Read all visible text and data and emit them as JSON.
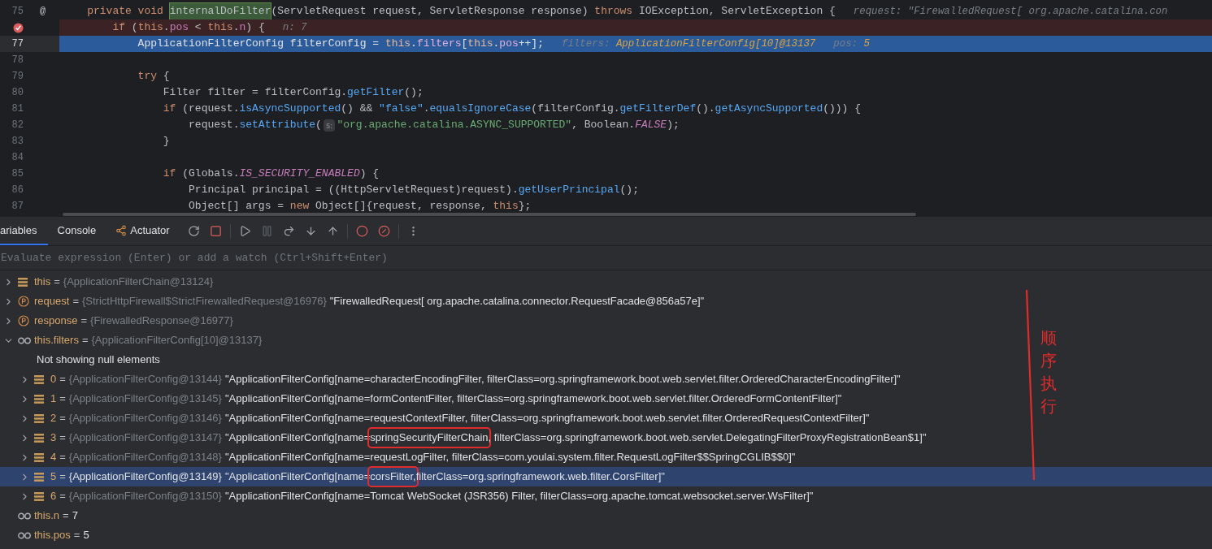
{
  "editor": {
    "lines": [
      {
        "number": "75",
        "gutter_mark": "@",
        "kind": "normal",
        "tokens": [
          {
            "t": "    private void ",
            "kind": "keyword"
          },
          {
            "t": "internalDoFilter",
            "kind": "usage"
          },
          {
            "t": "(ServletRequest request, ServletResponse response) ",
            "kind": "plain"
          },
          {
            "t": "throws",
            "kind": "keyword"
          },
          {
            "t": " IOException, ServletException {",
            "kind": "plain"
          }
        ],
        "hints": [
          {
            "label": "request: \"FirewalledRequest[ org.apache.catalina.con"
          }
        ]
      },
      {
        "kind": "breakpoint",
        "tokens": [
          {
            "t": "        if",
            "kind": "keyword"
          },
          {
            "t": " (",
            "kind": "plain"
          },
          {
            "t": "this",
            "kind": "keyword"
          },
          {
            "t": ".",
            "kind": "plain"
          },
          {
            "t": "pos",
            "kind": "field"
          },
          {
            "t": " < ",
            "kind": "plain"
          },
          {
            "t": "this",
            "kind": "keyword"
          },
          {
            "t": ".",
            "kind": "plain"
          },
          {
            "t": "n",
            "kind": "field"
          },
          {
            "t": ") {",
            "kind": "plain"
          }
        ],
        "hints": [
          {
            "label": "n: 7"
          }
        ]
      },
      {
        "number": "77",
        "kind": "current",
        "tokens": [
          {
            "t": "            ApplicationFilterConfig filterConfig = ",
            "kind": "plain"
          },
          {
            "t": "this",
            "kind": "keyword"
          },
          {
            "t": ".",
            "kind": "plain"
          },
          {
            "t": "filters",
            "kind": "field"
          },
          {
            "t": "[",
            "kind": "plain"
          },
          {
            "t": "this",
            "kind": "keyword"
          },
          {
            "t": ".",
            "kind": "plain"
          },
          {
            "t": "pos",
            "kind": "field"
          },
          {
            "t": "++];",
            "kind": "plain"
          }
        ],
        "hints": [
          {
            "label": "filters:",
            "value": "ApplicationFilterConfig[10]@13137"
          },
          {
            "label": "pos:",
            "value": "5"
          }
        ]
      },
      {
        "number": "78",
        "kind": "normal"
      },
      {
        "number": "79",
        "kind": "normal",
        "tokens": [
          {
            "t": "            try",
            "kind": "keyword"
          },
          {
            "t": " {",
            "kind": "plain"
          }
        ]
      },
      {
        "number": "80",
        "kind": "normal",
        "tokens": [
          {
            "t": "                Filter filter = filterConfig.",
            "kind": "plain"
          },
          {
            "t": "getFilter",
            "kind": "method"
          },
          {
            "t": "();",
            "kind": "plain"
          }
        ]
      },
      {
        "number": "81",
        "kind": "normal",
        "tokens": [
          {
            "t": "                if",
            "kind": "keyword"
          },
          {
            "t": " (request.",
            "kind": "plain"
          },
          {
            "t": "isAsyncSupported",
            "kind": "method"
          },
          {
            "t": "() && ",
            "kind": "plain"
          },
          {
            "t": "\"false\"",
            "kind": "method"
          },
          {
            "t": ".",
            "kind": "plain"
          },
          {
            "t": "equalsIgnoreCase",
            "kind": "method"
          },
          {
            "t": "(filterConfig.",
            "kind": "plain"
          },
          {
            "t": "getFilterDef",
            "kind": "method"
          },
          {
            "t": "().",
            "kind": "plain"
          },
          {
            "t": "getAsyncSupported",
            "kind": "method"
          },
          {
            "t": "())) {",
            "kind": "plain"
          }
        ]
      },
      {
        "number": "82",
        "kind": "normal",
        "tokens": [
          {
            "t": "                    request.",
            "kind": "plain"
          },
          {
            "t": "setAttribute",
            "kind": "method"
          },
          {
            "t": "(",
            "kind": "plain"
          },
          {
            "t": "s:",
            "kind": "param"
          },
          {
            "t": "\"org.apache.catalina.ASYNC_SUPPORTED\"",
            "kind": "string"
          },
          {
            "t": ", Boolean.",
            "kind": "plain"
          },
          {
            "t": "FALSE",
            "kind": "constant"
          },
          {
            "t": ");",
            "kind": "plain"
          }
        ]
      },
      {
        "number": "83",
        "kind": "normal",
        "tokens": [
          {
            "t": "                }",
            "kind": "plain"
          }
        ]
      },
      {
        "number": "84",
        "kind": "normal"
      },
      {
        "number": "85",
        "kind": "normal",
        "tokens": [
          {
            "t": "                if",
            "kind": "keyword"
          },
          {
            "t": " (Globals.",
            "kind": "plain"
          },
          {
            "t": "IS_SECURITY_ENABLED",
            "kind": "constant"
          },
          {
            "t": ") {",
            "kind": "plain"
          }
        ]
      },
      {
        "number": "86",
        "kind": "normal",
        "tokens": [
          {
            "t": "                    Principal principal = ((HttpServletRequest)request).",
            "kind": "plain"
          },
          {
            "t": "getUserPrincipal",
            "kind": "method"
          },
          {
            "t": "();",
            "kind": "plain"
          }
        ]
      },
      {
        "number": "87",
        "kind": "normal",
        "tokens": [
          {
            "t": "                    Object[] args = ",
            "kind": "plain"
          },
          {
            "t": "new",
            "kind": "keyword"
          },
          {
            "t": " Object[]{request, response, ",
            "kind": "plain"
          },
          {
            "t": "this",
            "kind": "keyword"
          },
          {
            "t": "};",
            "kind": "plain"
          }
        ]
      }
    ]
  },
  "debug_tabs": [
    {
      "label": "ariables",
      "selected": true
    },
    {
      "label": "Console",
      "selected": false
    },
    {
      "label": "Actuator",
      "selected": false
    }
  ],
  "evaluate": {
    "placeholder": "Evaluate expression (Enter) or add a watch (Ctrl+Shift+Enter)"
  },
  "variables": [
    {
      "kind": "field",
      "name": "this",
      "equals": "=",
      "value": "{ApplicationFilterChain@13124}",
      "expanded": false,
      "selected": false
    },
    {
      "kind": "param",
      "name": "request",
      "equals": "=",
      "value": "{StrictHttpFirewall$StrictFirewalledRequest@16976}",
      "string": [
        {
          "text": "\"FirewalledRequest[ org.apache.catalina.connector.RequestFacade@856a57e]\"",
          "boxed": false
        }
      ],
      "expanded": false,
      "selected": false
    },
    {
      "kind": "param",
      "name": "response",
      "equals": "=",
      "value": "{FirewalledResponse@16977}",
      "expanded": false,
      "selected": false
    },
    {
      "kind": "watch",
      "name": "this.filters",
      "equals": "=",
      "value": "{ApplicationFilterConfig[10]@13137}",
      "expanded": true,
      "selected": false,
      "note": "Not showing null elements",
      "children": [
        {
          "kind": "field",
          "name": "0",
          "equals": "=",
          "value": "{ApplicationFilterConfig@13144}",
          "string": [
            {
              "text": "\"ApplicationFilterConfig[name=characterEncodingFilter, filterClass=org.springframework.boot.web.servlet.filter.OrderedCharacterEncodingFilter]\"",
              "boxed": false
            }
          ],
          "expanded": false,
          "selected": false
        },
        {
          "kind": "field",
          "name": "1",
          "equals": "=",
          "value": "{ApplicationFilterConfig@13145}",
          "string": [
            {
              "text": "\"ApplicationFilterConfig[name=formContentFilter, filterClass=org.springframework.boot.web.servlet.filter.OrderedFormContentFilter]\"",
              "boxed": false
            }
          ],
          "expanded": false,
          "selected": false
        },
        {
          "kind": "field",
          "name": "2",
          "equals": "=",
          "value": "{ApplicationFilterConfig@13146}",
          "string": [
            {
              "text": "\"ApplicationFilterConfig[name=requestContextFilter, filterClass=org.springframework.boot.web.servlet.filter.OrderedRequestContextFilter]\"",
              "boxed": false
            }
          ],
          "expanded": false,
          "selected": false
        },
        {
          "kind": "field",
          "name": "3",
          "equals": "=",
          "value": "{ApplicationFilterConfig@13147}",
          "string": [
            {
              "text": "\"ApplicationFilterConfig[name=",
              "boxed": false
            },
            {
              "text": "springSecurityFilterChain",
              "boxed": true
            },
            {
              "text": ", filterClass=org.springframework.boot.web.servlet.DelegatingFilterProxyRegistrationBean$1]\"",
              "boxed": false
            }
          ],
          "expanded": false,
          "selected": false
        },
        {
          "kind": "field",
          "name": "4",
          "equals": "=",
          "value": "{ApplicationFilterConfig@13148}",
          "string": [
            {
              "text": "\"ApplicationFilterConfig[name=requestLogFilter, filterClass=com.youlai.system.filter.RequestLogFilter$$SpringCGLIB$$0]\"",
              "boxed": false
            }
          ],
          "expanded": false,
          "selected": false
        },
        {
          "kind": "field",
          "name": "5",
          "equals": "=",
          "value": "{ApplicationFilterConfig@13149}",
          "string": [
            {
              "text": "\"ApplicationFilterConfig[name=",
              "boxed": false
            },
            {
              "text": "corsFilter,",
              "boxed": true
            },
            {
              "text": " filterClass=org.springframework.web.filter.CorsFilter]\"",
              "boxed": false
            }
          ],
          "expanded": false,
          "selected": true
        },
        {
          "kind": "field",
          "name": "6",
          "equals": "=",
          "value": "{ApplicationFilterConfig@13150}",
          "string": [
            {
              "text": "\"ApplicationFilterConfig[name=Tomcat WebSocket (JSR356) Filter, filterClass=org.apache.tomcat.websocket.server.WsFilter]\"",
              "boxed": false
            }
          ],
          "expanded": false,
          "selected": false
        }
      ]
    },
    {
      "kind": "watch",
      "name": "this.n",
      "equals": "=",
      "value": "7",
      "primitive": true,
      "selected": false
    },
    {
      "kind": "watch",
      "name": "this.pos",
      "equals": "=",
      "value": "5",
      "primitive": true,
      "selected": false
    }
  ],
  "annotation": {
    "text": "顺序执行"
  }
}
